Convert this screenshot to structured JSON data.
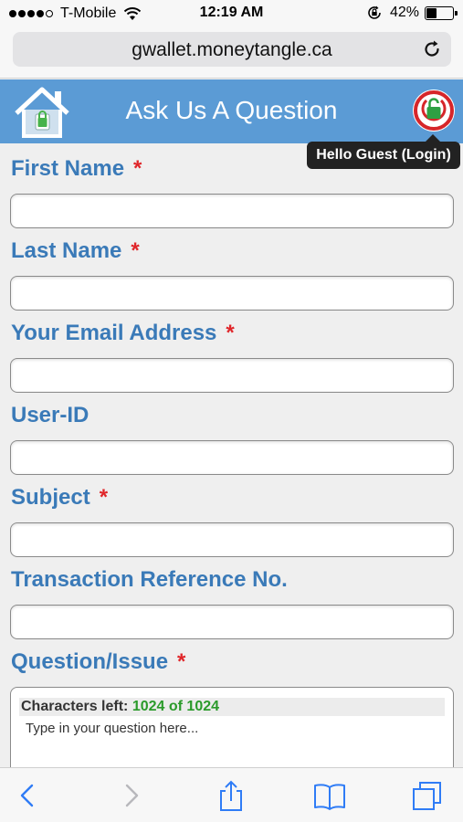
{
  "status_bar": {
    "carrier": "T-Mobile",
    "time": "12:19 AM",
    "battery_percent": "42%",
    "battery_level": 0.42
  },
  "browser": {
    "url": "gwallet.moneytangle.ca"
  },
  "header": {
    "title": "Ask Us A Question",
    "login_tooltip": "Hello Guest (Login)"
  },
  "form": {
    "required_marker": "*",
    "fields": [
      {
        "label": "First Name",
        "required": true,
        "value": ""
      },
      {
        "label": "Last Name",
        "required": true,
        "value": ""
      },
      {
        "label": "Your Email Address",
        "required": true,
        "value": ""
      },
      {
        "label": "User-ID",
        "required": false,
        "value": ""
      },
      {
        "label": "Subject",
        "required": true,
        "value": ""
      },
      {
        "label": "Transaction Reference No.",
        "required": false,
        "value": ""
      }
    ],
    "question": {
      "label": "Question/Issue",
      "required": true,
      "chars_left_label": "Characters left:",
      "chars_left_value": "1024 of 1024",
      "placeholder": "Type in your question here..."
    }
  },
  "colors": {
    "header_bg": "#5b9bd5",
    "label_blue": "#3a7ab8",
    "required_red": "#e0262a",
    "chars_green": "#2a9a2a",
    "ios_blue": "#2f7cf6"
  }
}
